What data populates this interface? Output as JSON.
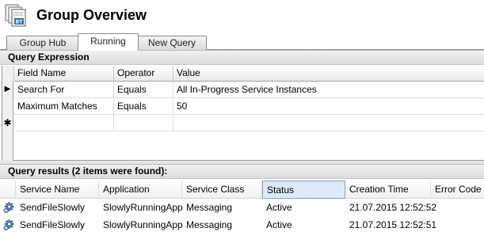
{
  "header": {
    "title": "Group Overview",
    "icon": "biztalk-console-icon",
    "icon_badge": "BT"
  },
  "tabs": [
    {
      "label": "Group Hub",
      "active": false
    },
    {
      "label": "Running",
      "active": true
    },
    {
      "label": "New Query",
      "active": false
    }
  ],
  "query_expression": {
    "title": "Query Expression",
    "columns": [
      "Field Name",
      "Operator",
      "Value"
    ],
    "rows": [
      {
        "field": "Search For",
        "operator": "Equals",
        "value": "All In-Progress Service Instances"
      },
      {
        "field": "Maximum Matches",
        "operator": "Equals",
        "value": "50"
      }
    ],
    "current_row_marker": "▶",
    "new_row_marker": "✱"
  },
  "query_results": {
    "title": "Query results (2 items were found):",
    "columns": [
      "Service Name",
      "Application",
      "Service Class",
      "Status",
      "Creation Time",
      "Error Code"
    ],
    "highlighted_column": "Status",
    "rows": [
      {
        "service_name": "SendFileSlowly",
        "application": "SlowlyRunningApp",
        "service_class": "Messaging",
        "status": "Active",
        "creation_time": "21.07.2015 12:52:52",
        "error_code": ""
      },
      {
        "service_name": "SendFileSlowly",
        "application": "SlowlyRunningApp",
        "service_class": "Messaging",
        "status": "Active",
        "creation_time": "21.07.2015 12:52:51",
        "error_code": ""
      }
    ],
    "row_icon": "gear-icon"
  }
}
